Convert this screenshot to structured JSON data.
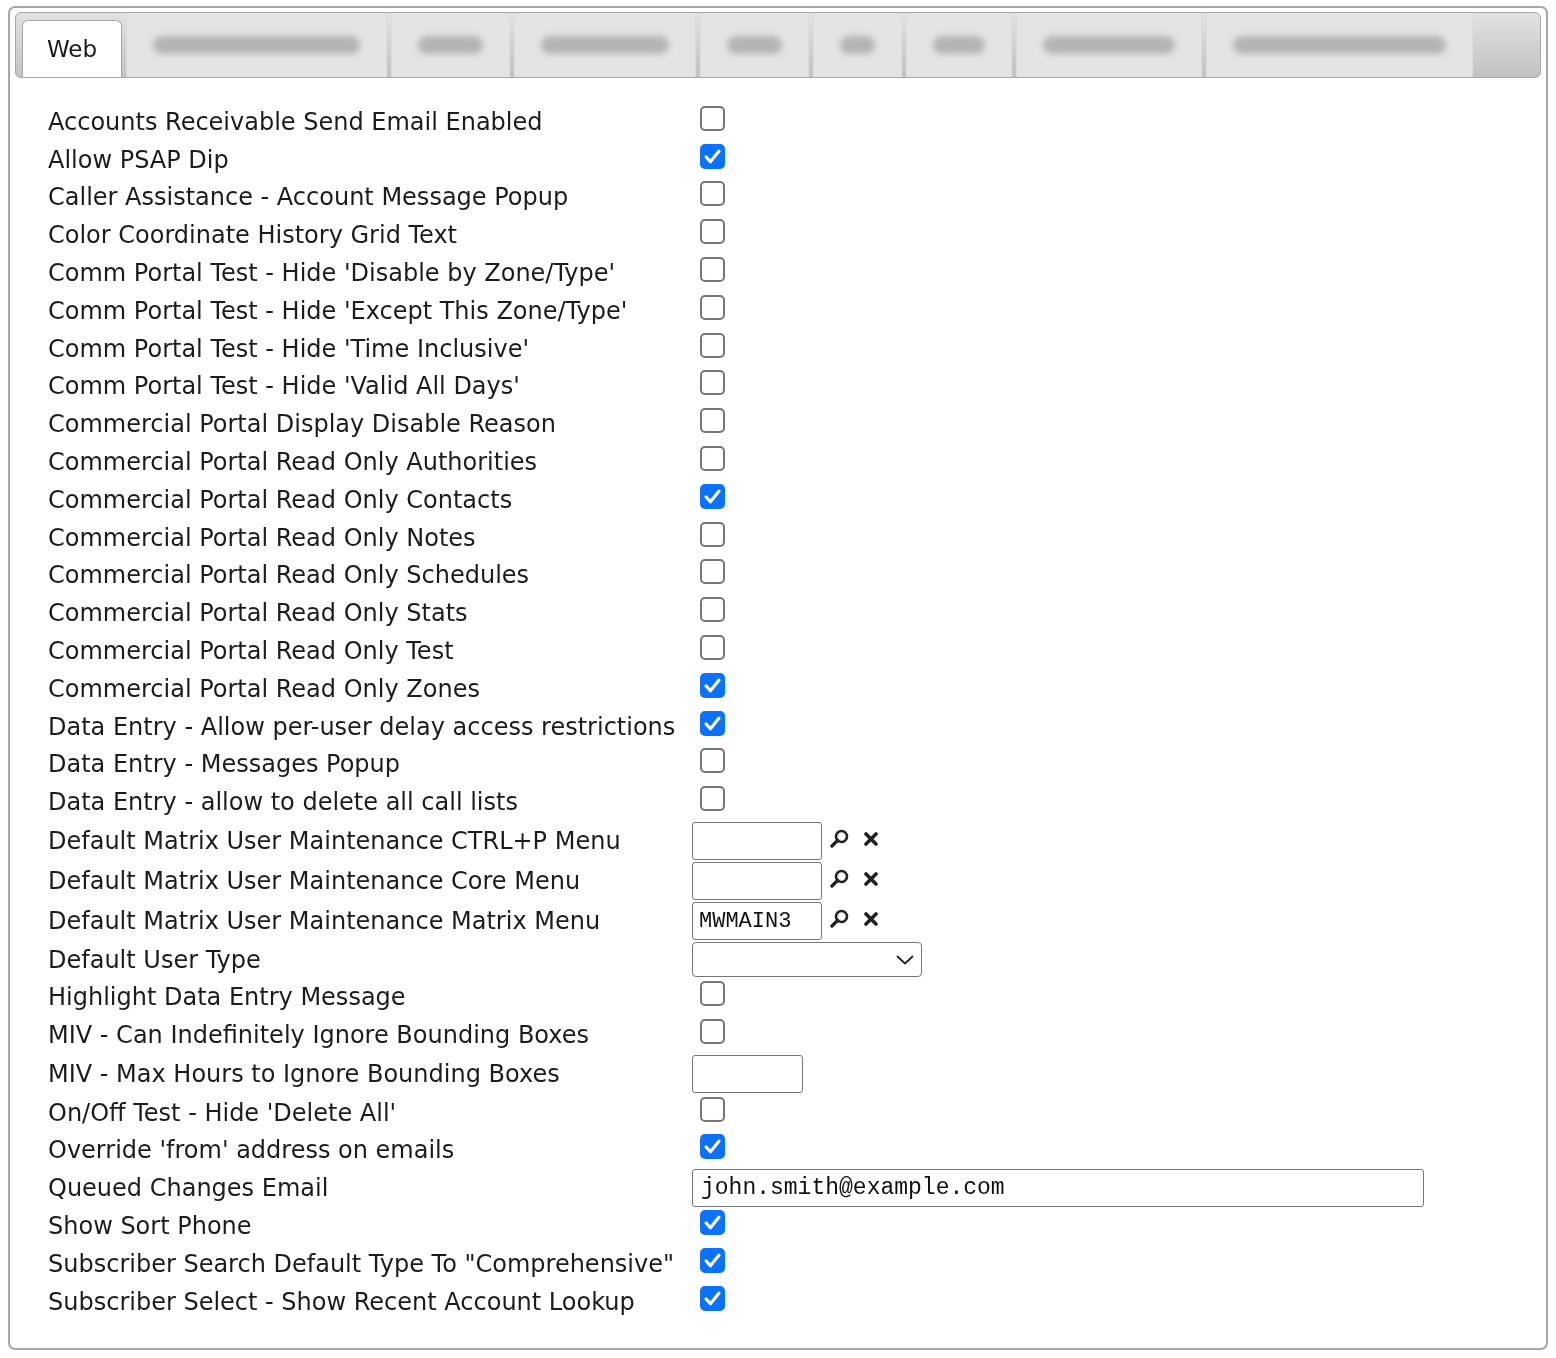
{
  "tabs": [
    {
      "kind": "text",
      "label": "Web",
      "selected": true
    },
    {
      "kind": "blurred",
      "selected": false
    },
    {
      "kind": "blurred",
      "selected": false
    },
    {
      "kind": "blurred",
      "selected": false
    },
    {
      "kind": "blurred",
      "selected": false
    },
    {
      "kind": "blurred",
      "selected": false
    },
    {
      "kind": "blurred",
      "selected": false
    },
    {
      "kind": "blurred",
      "selected": false
    },
    {
      "kind": "blurred",
      "selected": false
    }
  ],
  "settings": [
    {
      "kind": "checkbox",
      "label": "Accounts Receivable Send Email Enabled",
      "checked": false
    },
    {
      "kind": "checkbox",
      "label": "Allow PSAP Dip",
      "checked": true
    },
    {
      "kind": "checkbox",
      "label": "Caller Assistance - Account Message Popup",
      "checked": false
    },
    {
      "kind": "checkbox",
      "label": "Color Coordinate History Grid Text",
      "checked": false
    },
    {
      "kind": "checkbox",
      "label": "Comm Portal Test - Hide 'Disable by Zone/Type'",
      "checked": false
    },
    {
      "kind": "checkbox",
      "label": "Comm Portal Test - Hide 'Except This Zone/Type'",
      "checked": false
    },
    {
      "kind": "checkbox",
      "label": "Comm Portal Test - Hide 'Time Inclusive'",
      "checked": false
    },
    {
      "kind": "checkbox",
      "label": "Comm Portal Test - Hide 'Valid All Days'",
      "checked": false
    },
    {
      "kind": "checkbox",
      "label": "Commercial Portal Display Disable Reason",
      "checked": false
    },
    {
      "kind": "checkbox",
      "label": "Commercial Portal Read Only Authorities",
      "checked": false
    },
    {
      "kind": "checkbox",
      "label": "Commercial Portal Read Only Contacts",
      "checked": true
    },
    {
      "kind": "checkbox",
      "label": "Commercial Portal Read Only Notes",
      "checked": false
    },
    {
      "kind": "checkbox",
      "label": "Commercial Portal Read Only Schedules",
      "checked": false
    },
    {
      "kind": "checkbox",
      "label": "Commercial Portal Read Only Stats",
      "checked": false
    },
    {
      "kind": "checkbox",
      "label": "Commercial Portal Read Only Test",
      "checked": false
    },
    {
      "kind": "checkbox",
      "label": "Commercial Portal Read Only Zones",
      "checked": true
    },
    {
      "kind": "checkbox",
      "label": "Data Entry - Allow per-user delay access restrictions",
      "checked": true
    },
    {
      "kind": "checkbox",
      "label": "Data Entry - Messages Popup",
      "checked": false
    },
    {
      "kind": "checkbox",
      "label": "Data Entry - allow to delete all call lists",
      "checked": false
    },
    {
      "kind": "lookup",
      "label": "Default Matrix User Maintenance CTRL+P Menu"
    },
    {
      "kind": "lookup",
      "label": "Default Matrix User Maintenance Core Menu"
    },
    {
      "kind": "lookup",
      "label": "Default Matrix User Maintenance Matrix Menu",
      "value": "MWMAIN3"
    },
    {
      "kind": "select",
      "label": "Default User Type"
    },
    {
      "kind": "checkbox",
      "label": "Highlight Data Entry Message",
      "checked": false
    },
    {
      "kind": "checkbox",
      "label": "MIV - Can Indefinitely Ignore Bounding Boxes",
      "checked": false
    },
    {
      "kind": "number",
      "label": "MIV - Max Hours to Ignore Bounding Boxes"
    },
    {
      "kind": "checkbox",
      "label": "On/Off Test - Hide 'Delete All'",
      "checked": false
    },
    {
      "kind": "checkbox",
      "label": "Override 'from' address on emails",
      "checked": true
    },
    {
      "kind": "email",
      "label": "Queued Changes Email",
      "value": "john.smith@example.com"
    },
    {
      "kind": "checkbox",
      "label": "Show Sort Phone",
      "checked": true
    },
    {
      "kind": "checkbox",
      "label": "Subscriber Search Default Type To \"Comprehensive\"",
      "checked": true
    },
    {
      "kind": "checkbox",
      "label": "Subscriber Select - Show Recent Account Lookup",
      "checked": true
    }
  ]
}
